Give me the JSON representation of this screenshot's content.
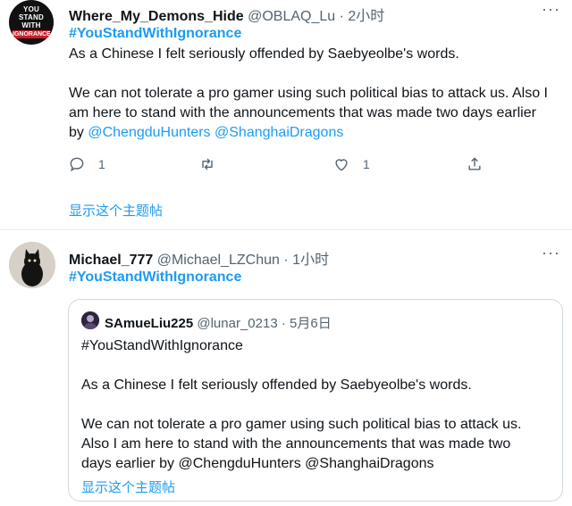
{
  "tweet1": {
    "avatar_lines": [
      "YOU",
      "STAND",
      "WITH"
    ],
    "avatar_band": "IGNORANCE",
    "display_name": "Where_My_Demons_Hide",
    "handle": "@OBLAQ_Lu",
    "separator": "·",
    "time": "2小时",
    "hashtag": "#YouStandWithIgnorance",
    "line1": "As a Chinese I felt seriously offended by Saebyeolbe's words.",
    "line2": "We can not tolerate a pro gamer using such political bias to attack us. Also I",
    "line3": "am here to stand with the announcements that was made two days earlier",
    "line4_prefix": "by ",
    "mention1": "@ChengduHunters",
    "mention2": "@ShanghaiDragons",
    "reply_count": "1",
    "retweet_count": "",
    "like_count": "1",
    "show_thread": "显示这个主题帖"
  },
  "tweet2": {
    "display_name": "Michael_777",
    "handle": "@Michael_LZChun",
    "separator": "·",
    "time": "1小时",
    "hashtag": "#YouStandWithIgnorance"
  },
  "quote": {
    "display_name": "SAmueLiu225",
    "handle": "@lunar_0213",
    "separator": "·",
    "date": "5月6日",
    "hashtag": "#YouStandWithIgnorance",
    "line1": "As a Chinese I felt seriously offended by Saebyeolbe's words.",
    "line2": "We can not tolerate a pro gamer using such political bias to attack us.",
    "line3": "Also I am here to stand with the announcements that was made two",
    "line4": "days earlier by @ChengduHunters @ShanghaiDragons",
    "show_thread": "显示这个主题帖"
  },
  "more_glyph": "···",
  "colors": {
    "link": "#1d9bf0",
    "muted": "#536471",
    "border": "#cfd9de"
  },
  "icons": [
    "reply-icon",
    "retweet-icon",
    "like-icon",
    "share-icon",
    "more-icon"
  ]
}
